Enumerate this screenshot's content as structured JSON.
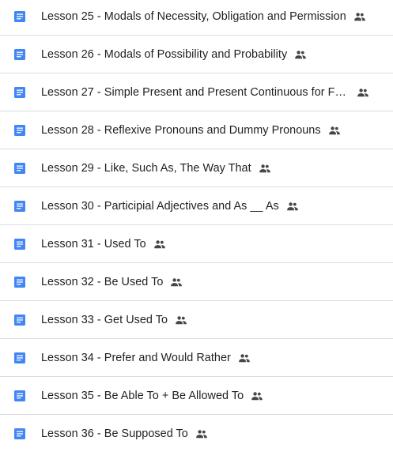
{
  "files": [
    {
      "name": "Lesson 25 - Modals of Necessity, Obligation and Permission",
      "icon": "google-doc-icon",
      "shared_icon": "people-icon"
    },
    {
      "name": "Lesson 26 - Modals of Possibility and Probability",
      "icon": "google-doc-icon",
      "shared_icon": "people-icon"
    },
    {
      "name": "Lesson 27 - Simple Present and Present Continuous for Futu...",
      "icon": "google-doc-icon",
      "shared_icon": "people-icon"
    },
    {
      "name": "Lesson 28 - Reflexive Pronouns and Dummy Pronouns",
      "icon": "google-doc-icon",
      "shared_icon": "people-icon"
    },
    {
      "name": "Lesson 29 - Like, Such As, The Way That",
      "icon": "google-doc-icon",
      "shared_icon": "people-icon"
    },
    {
      "name": "Lesson 30 - Participial Adjectives and As __ As",
      "icon": "google-doc-icon",
      "shared_icon": "people-icon"
    },
    {
      "name": "Lesson 31 - Used To",
      "icon": "google-doc-icon",
      "shared_icon": "people-icon"
    },
    {
      "name": "Lesson 32 - Be Used To",
      "icon": "google-doc-icon",
      "shared_icon": "people-icon"
    },
    {
      "name": "Lesson 33 - Get Used To",
      "icon": "google-doc-icon",
      "shared_icon": "people-icon"
    },
    {
      "name": "Lesson 34 - Prefer and Would Rather",
      "icon": "google-doc-icon",
      "shared_icon": "people-icon"
    },
    {
      "name": "Lesson 35 - Be Able To + Be Allowed To",
      "icon": "google-doc-icon",
      "shared_icon": "people-icon"
    },
    {
      "name": "Lesson 36 - Be Supposed To",
      "icon": "google-doc-icon",
      "shared_icon": "people-icon"
    }
  ],
  "colors": {
    "doc_icon": "#4285f4",
    "text": "#1f1f1f",
    "shared_icon": "#444746",
    "divider": "#dadce0"
  }
}
